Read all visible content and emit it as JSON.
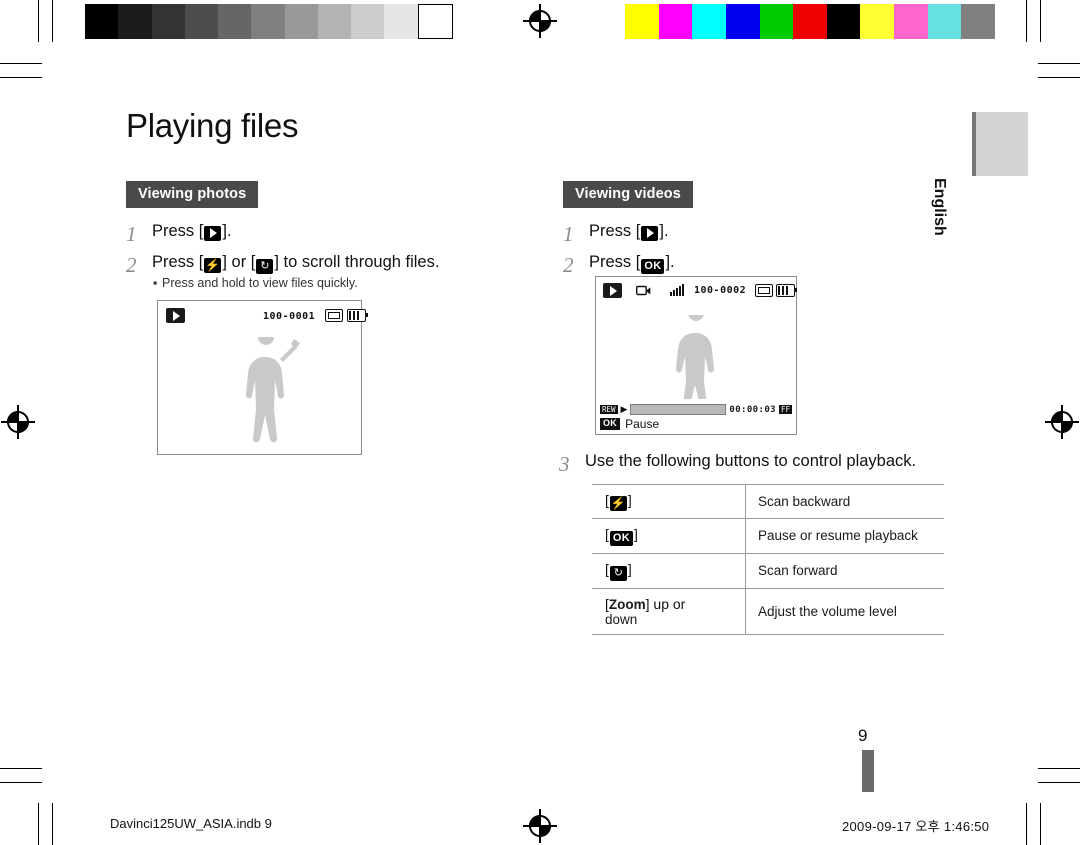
{
  "document": {
    "title": "Playing files",
    "page_number": "9",
    "side_tab_label": "English",
    "footer_left": "Davinci125UW_ASIA.indb   9",
    "footer_right": "2009-09-17   오후 1:46:50"
  },
  "left_column": {
    "section_heading": "Viewing photos",
    "steps": [
      {
        "num": "1",
        "text_before": "Press [",
        "key": "play-icon",
        "text_after": "]."
      },
      {
        "num": "2",
        "text_parts": [
          "Press [",
          "flash-icon",
          "] or [",
          "timer-icon",
          "] to scroll through files."
        ]
      }
    ],
    "bullet": "Press and hold to view files quickly.",
    "lcd": {
      "file_number": "100-0001",
      "play_icon": "play-icon",
      "memory_icon": "memory-card-icon",
      "battery_icon": "battery-icon"
    }
  },
  "right_column": {
    "section_heading": "Viewing videos",
    "steps": [
      {
        "num": "1",
        "text_before": "Press [",
        "key": "play-icon",
        "text_after": "]."
      },
      {
        "num": "2",
        "text_before": "Press [",
        "key": "OK",
        "text_after": "]."
      },
      {
        "num": "3",
        "text": "Use the following buttons to control playback."
      }
    ],
    "lcd": {
      "file_number": "100-0002",
      "play_icon": "play-icon",
      "record_icon": "movie-icon",
      "signal_icon": "signal-bars-icon",
      "memory_icon": "memory-card-icon",
      "battery_icon": "battery-icon",
      "timecode": "00:00:03",
      "ok_badge": "OK",
      "status_label": "Pause",
      "left_badge": "REW",
      "right_badge": "FF"
    },
    "button_table": {
      "rows": [
        {
          "key_open": "[",
          "key_icon": "flash-icon",
          "key_close": "]",
          "key_text": "",
          "description": "Scan backward"
        },
        {
          "key_open": "[",
          "key_icon": "",
          "key_close": "]",
          "key_text": "OK",
          "description": "Pause or resume playback"
        },
        {
          "key_open": "[",
          "key_icon": "timer-icon",
          "key_close": "]",
          "key_text": "",
          "description": "Scan forward"
        },
        {
          "key_open": "[",
          "key_icon": "",
          "key_close": "] up or",
          "key_text": "Zoom",
          "key_text2": "down",
          "description": "Adjust the volume level"
        }
      ]
    }
  },
  "print_marks": {
    "grayscale_steps": [
      "#000000",
      "#1c1c1c",
      "#333333",
      "#4d4d4d",
      "#666666",
      "#808080",
      "#999999",
      "#b3b3b3",
      "#cccccc",
      "#e6e6e6",
      "#ffffff"
    ],
    "color_steps": [
      "#ffff00",
      "#ff00ff",
      "#00ffff",
      "#0000ee",
      "#00cc00",
      "#ee0000",
      "#000000",
      "#ffff33",
      "#ff66cc",
      "#66e0e0",
      "#808080"
    ]
  }
}
